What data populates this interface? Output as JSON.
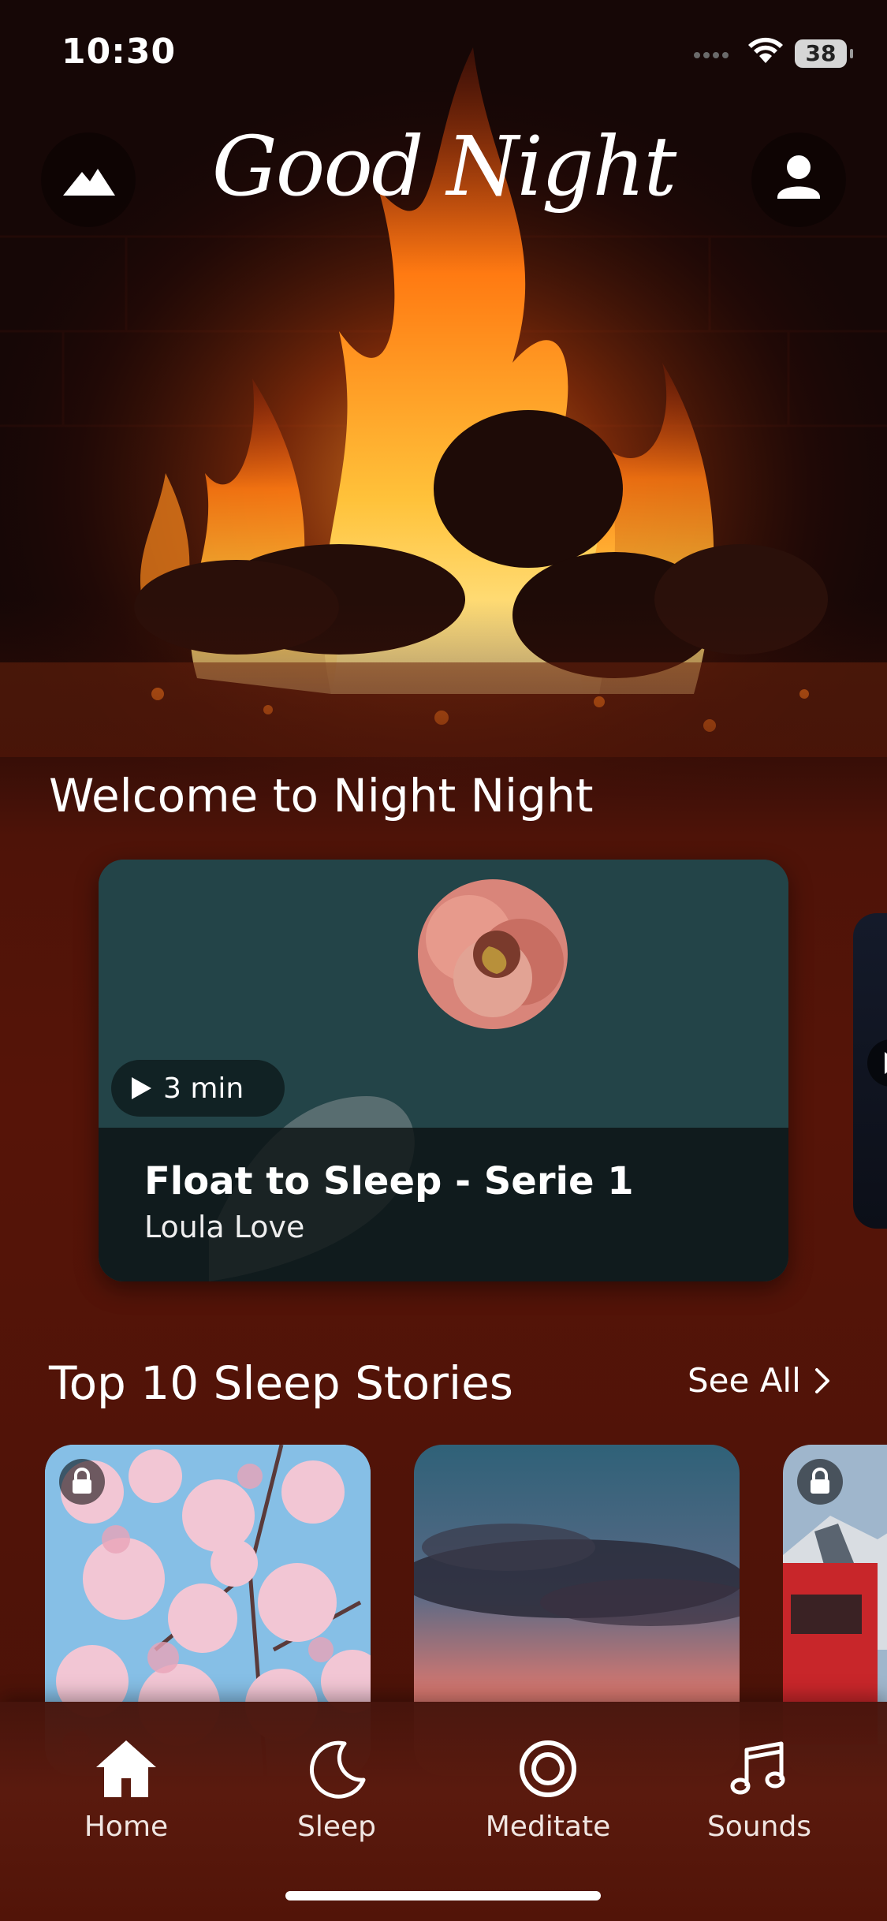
{
  "status_bar": {
    "time": "10:30",
    "battery": "38"
  },
  "header": {
    "title": "Good Night"
  },
  "welcome": {
    "heading": "Welcome to Night Night",
    "featured": {
      "duration": "3 min",
      "title": "Float to Sleep - Serie 1",
      "author": "Loula Love"
    }
  },
  "top10": {
    "heading": "Top 10 Sleep Stories",
    "see_all": "See All",
    "items": [
      {
        "locked": true,
        "art": "cherry-blossom"
      },
      {
        "locked": false,
        "art": "dusk-clouds"
      },
      {
        "locked": true,
        "art": "red-train"
      }
    ]
  },
  "tabs": [
    {
      "label": "Home",
      "icon": "home-icon",
      "active": true
    },
    {
      "label": "Sleep",
      "icon": "moon-icon",
      "active": false
    },
    {
      "label": "Meditate",
      "icon": "ring-icon",
      "active": false
    },
    {
      "label": "Sounds",
      "icon": "music-note-icon",
      "active": false
    }
  ],
  "colors": {
    "background": "#4e1308",
    "tabbar": "#5a1a0e",
    "flame": "#ff8a1c"
  }
}
